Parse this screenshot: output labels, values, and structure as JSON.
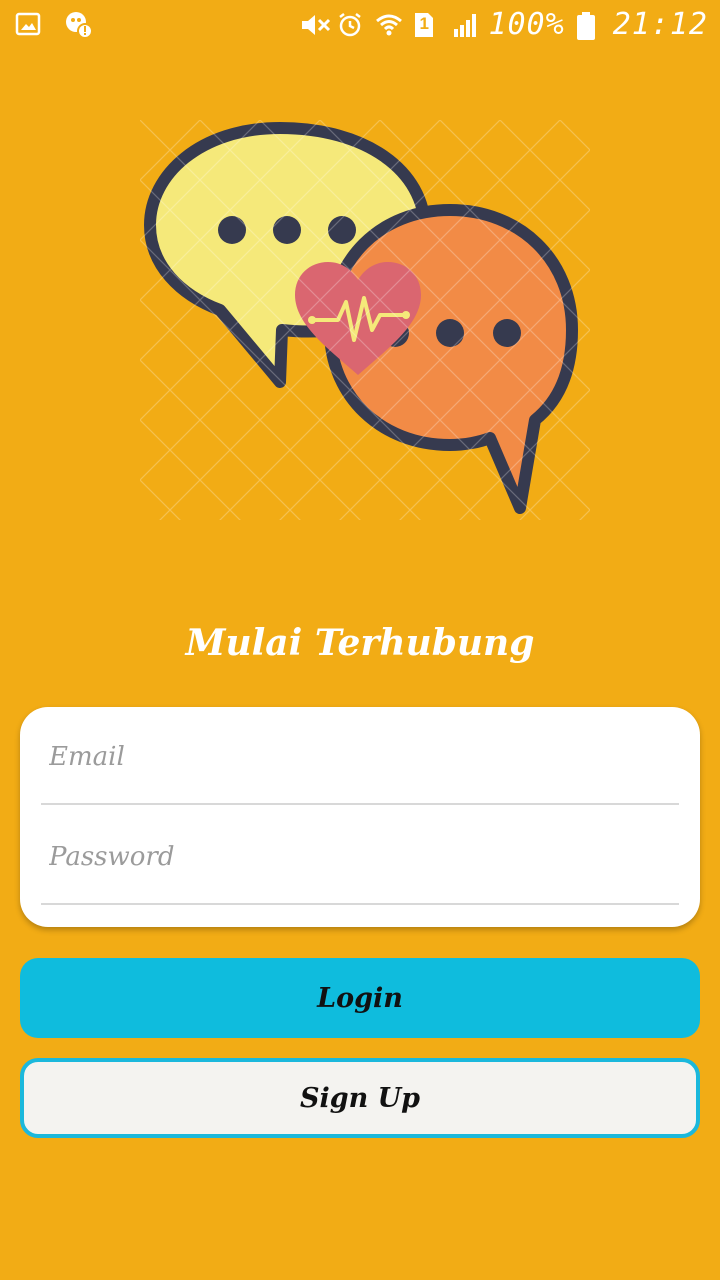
{
  "status_bar": {
    "battery": "100%",
    "time": "21:12",
    "sim_slot": "1",
    "icons": [
      "gallery-icon",
      "notification-alert-icon",
      "mute-icon",
      "alarm-icon",
      "wifi-icon",
      "sim-icon",
      "signal-icon",
      "battery-icon"
    ]
  },
  "illustration": {
    "icons": [
      "speech-bubble-yellow-icon",
      "speech-bubble-orange-icon",
      "heart-pulse-icon"
    ],
    "colors": {
      "yellow_bubble": "#F5E97A",
      "orange_bubble": "#F28B46",
      "heart": "#DA6670",
      "outline": "#363A4F"
    }
  },
  "title": "Mulai Terhubung",
  "form": {
    "email_placeholder": "Email",
    "password_placeholder": "Password"
  },
  "buttons": {
    "login": "Login",
    "signup": "Sign Up"
  },
  "colors": {
    "background": "#F2AC15",
    "login_button": "#0FBCDD",
    "signup_border": "#1BB8DC"
  }
}
